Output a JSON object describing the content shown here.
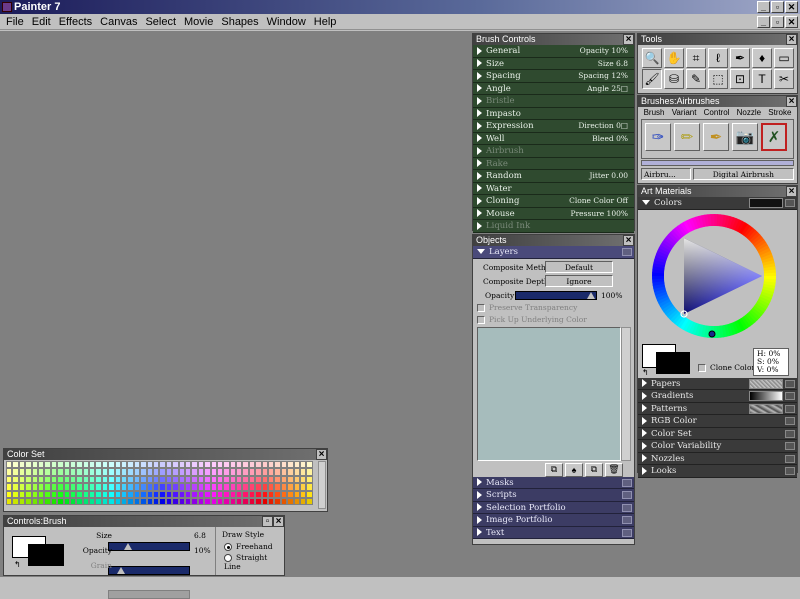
{
  "app": {
    "title": "Painter 7"
  },
  "menu": [
    "File",
    "Edit",
    "Effects",
    "Canvas",
    "Select",
    "Movie",
    "Shapes",
    "Window",
    "Help"
  ],
  "brush_controls": {
    "title": "Brush Controls",
    "rows": [
      {
        "label": "General",
        "value": "Opacity 10%",
        "enabled": true
      },
      {
        "label": "Size",
        "value": "Size 6.8",
        "enabled": true
      },
      {
        "label": "Spacing",
        "value": "Spacing 12%",
        "enabled": true
      },
      {
        "label": "Angle",
        "value": "Angle 25□",
        "enabled": true
      },
      {
        "label": "Bristle",
        "value": "",
        "enabled": false
      },
      {
        "label": "Impasto",
        "value": "",
        "enabled": true
      },
      {
        "label": "Expression",
        "value": "Direction 0□",
        "enabled": true
      },
      {
        "label": "Well",
        "value": "Bleed 0%",
        "enabled": true
      },
      {
        "label": "Airbrush",
        "value": "",
        "enabled": false
      },
      {
        "label": "Rake",
        "value": "",
        "enabled": false
      },
      {
        "label": "Random",
        "value": "Jitter 0.00",
        "enabled": true
      },
      {
        "label": "Water",
        "value": "",
        "enabled": true
      },
      {
        "label": "Cloning",
        "value": "Clone Color Off",
        "enabled": true
      },
      {
        "label": "Mouse",
        "value": "Pressure 100%",
        "enabled": true
      },
      {
        "label": "Liquid Ink",
        "value": "",
        "enabled": false
      }
    ]
  },
  "tools": {
    "title": "Tools"
  },
  "brushes": {
    "title": "Brushes:Airbrushes",
    "tabs": [
      "Brush",
      "Variant",
      "Control",
      "Nozzle",
      "Stroke"
    ],
    "category": "Airbru...",
    "variant": "Digital Airbrush"
  },
  "art_materials": {
    "title": "Art Materials",
    "colors_label": "Colors",
    "clone_color_label": "Clone Color",
    "hsv": [
      "H:  0%",
      "S:  0%",
      "V:  0%"
    ],
    "sections": [
      "Papers",
      "Gradients",
      "Patterns",
      "RGB Color",
      "Color Set",
      "Color Variability",
      "Nozzles",
      "Looks"
    ]
  },
  "objects": {
    "title": "Objects",
    "layers_label": "Layers",
    "composite_method_label": "Composite Method",
    "composite_method_value": "Default",
    "composite_depth_label": "Composite Depth",
    "composite_depth_value": "Ignore",
    "opacity_label": "Opacity",
    "opacity_value": "100%",
    "opacity_level": 1.0,
    "preserve_label": "Preserve Transparency",
    "pickup_label": "Pick Up Underlying Color",
    "sections": [
      "Masks",
      "Scripts",
      "Selection Portfolio",
      "Image Portfolio",
      "Text"
    ]
  },
  "color_set": {
    "title": "Color Set"
  },
  "controls_brush": {
    "title": "Controls:Brush",
    "size_label": "Size",
    "size_value": "6.8",
    "size_level": 0.2,
    "opacity_label": "Opacity",
    "opacity_value": "10%",
    "opacity_level": 0.1,
    "grain_label": "Grain",
    "draw_style_label": "Draw Style",
    "freehand_label": "Freehand",
    "straight_label": "Straight Line"
  }
}
